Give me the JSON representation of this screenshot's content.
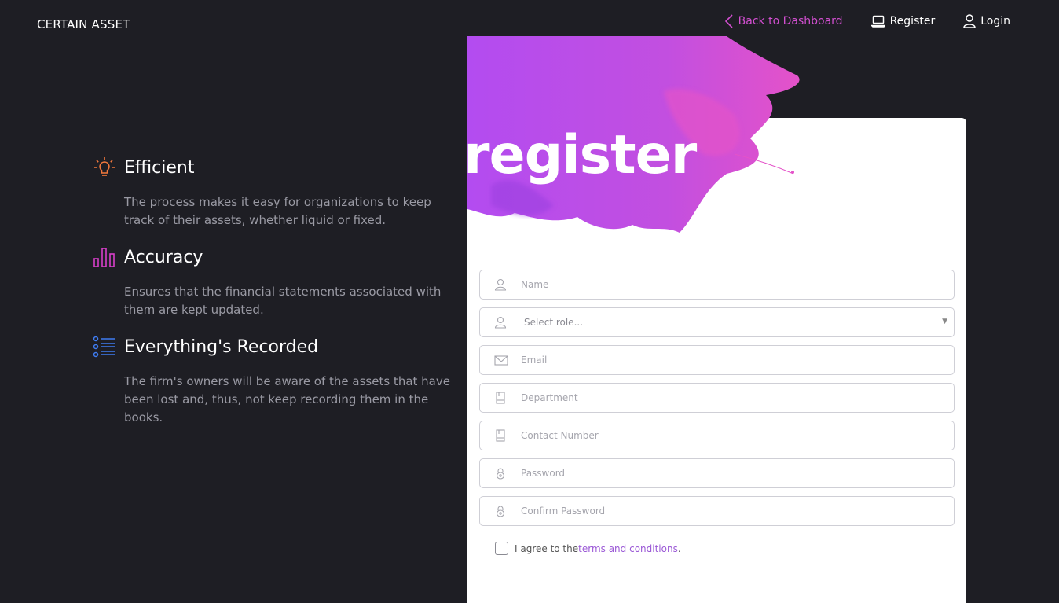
{
  "brand": "CERTAIN ASSET",
  "nav": {
    "back_label": "Back to Dashboard",
    "register_label": "Register",
    "login_label": "Login"
  },
  "features": [
    {
      "title": "Efficient",
      "desc": "The process makes it easy for organizations to keep track of their assets, whether liquid or fixed.",
      "icon": "lightbulb-icon",
      "color": "#f2783c"
    },
    {
      "title": "Accuracy",
      "desc": "Ensures that the financial statements associated with them are kept updated.",
      "icon": "bar-chart-icon",
      "color": "#d83fc9"
    },
    {
      "title": "Everything's Recorded",
      "desc": "The firm's owners will be aware of the assets that have been lost and, thus, not keep recording them in the books.",
      "icon": "list-icon",
      "color": "#3f7cf2"
    }
  ],
  "heading": "register",
  "form": {
    "name_placeholder": "Name",
    "role_placeholder": "Select role...",
    "email_placeholder": "Email",
    "department_placeholder": "Department",
    "contact_placeholder": "Contact Number",
    "password_placeholder": "Password",
    "confirm_placeholder": "Confirm Password",
    "agree_prefix": "I agree to the ",
    "terms_label": "terms and conditions",
    "agree_suffix": "."
  },
  "colors": {
    "accent_pink": "#d24fd0",
    "accent_purple": "#b34cf0",
    "link_purple": "#9b59d6",
    "background": "#1e1e24"
  }
}
